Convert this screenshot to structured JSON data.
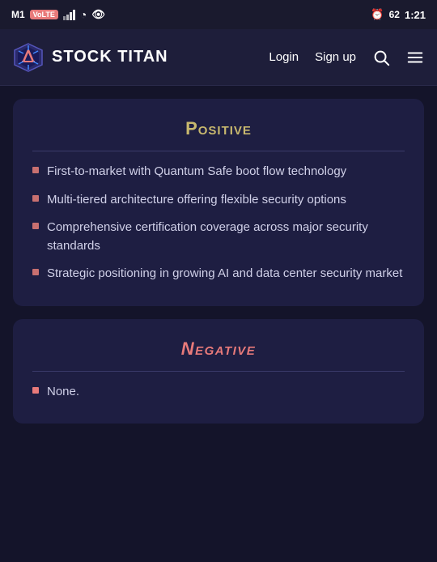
{
  "statusBar": {
    "carrier": "M1",
    "volte": "VoLTE",
    "time": "1:21",
    "battery": "62"
  },
  "header": {
    "brandName": "STOCK TITAN",
    "loginLabel": "Login",
    "signupLabel": "Sign up"
  },
  "positive": {
    "title": "Positive",
    "items": [
      "First-to-market with Quantum Safe boot flow technology",
      "Multi-tiered architecture offering flexible security options",
      "Comprehensive certification coverage across major security standards",
      "Strategic positioning in growing AI and data center security market"
    ]
  },
  "negative": {
    "title": "Negative",
    "items": [
      "None."
    ]
  }
}
